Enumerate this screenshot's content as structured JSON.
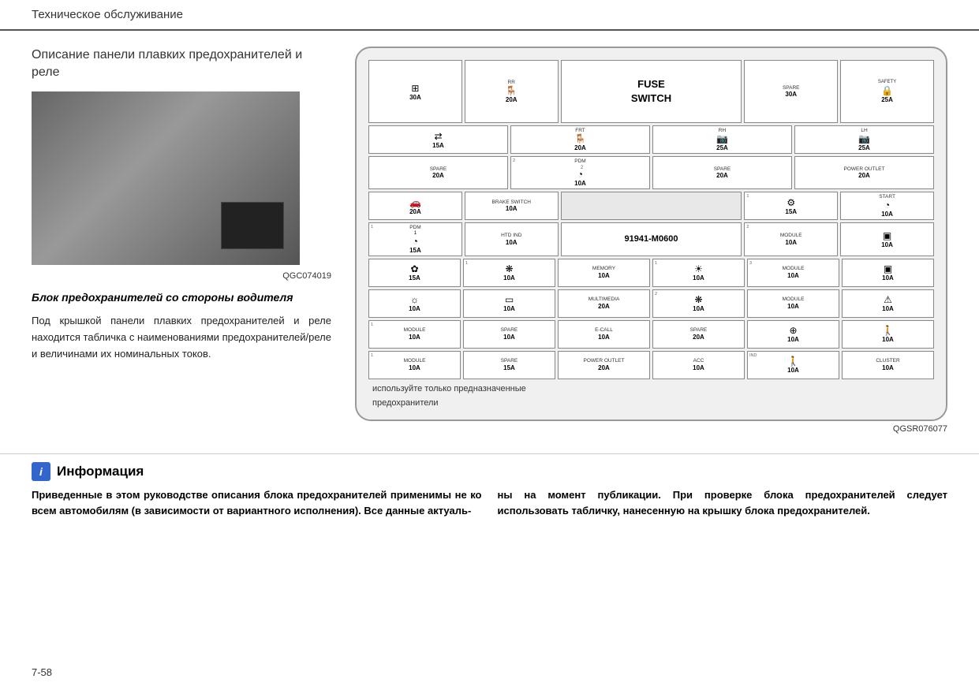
{
  "header": {
    "title": "Техническое обслуживание"
  },
  "left": {
    "section_title": "Описание панели плавких предохранителей и реле",
    "image_code": "QGC074019",
    "subtitle": "Блок предохранителей со стороны водителя",
    "description": "Под крышкой панели плавких предохранителей и реле находится табличка с наименованиями предохранителей/реле и величинами их номинальных токов."
  },
  "diagram": {
    "part_number": "91941-M0600",
    "image_code": "QGSR076077",
    "fuse_switch_label": "FUSE\nSWITCH",
    "note_line1": "используйте только предназначенные",
    "note_line2": "предохранители"
  },
  "info": {
    "icon": "i",
    "title": "Информация",
    "col1": "Приведенные в этом руководстве описания блока предохранителей применимы не ко всем автомобилям (в зависимости от вариантного исполнения). Все данные актуаль-",
    "col2": "ны на момент публикации. При проверке блока предохранителей следует использовать табличку, нанесенную на крышку блока предохранителей."
  },
  "page": {
    "number": "7-58"
  }
}
